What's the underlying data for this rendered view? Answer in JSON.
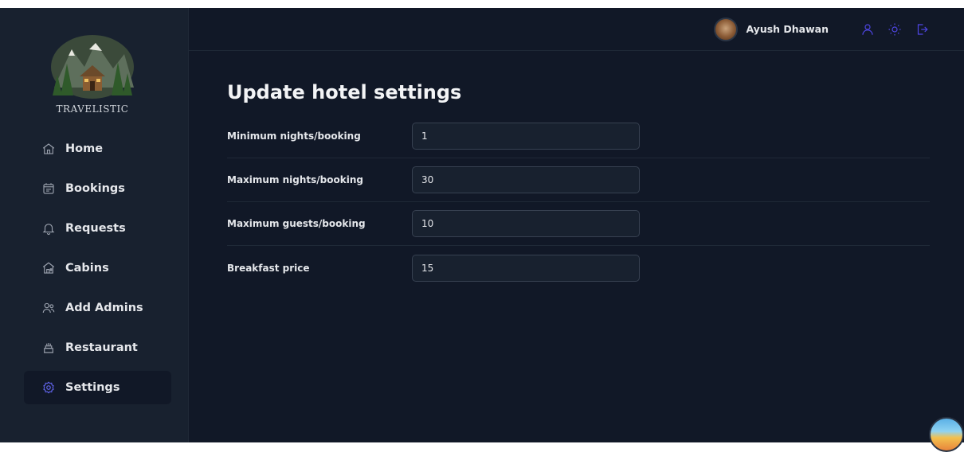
{
  "brand": {
    "name": "TRAVELISTIC"
  },
  "nav": [
    {
      "label": "Home",
      "icon": "home-icon",
      "active": false
    },
    {
      "label": "Bookings",
      "icon": "calendar-icon",
      "active": false
    },
    {
      "label": "Requests",
      "icon": "bell-icon",
      "active": false
    },
    {
      "label": "Cabins",
      "icon": "cabin-icon",
      "active": false
    },
    {
      "label": "Add Admins",
      "icon": "users-icon",
      "active": false
    },
    {
      "label": "Restaurant",
      "icon": "cake-icon",
      "active": false
    },
    {
      "label": "Settings",
      "icon": "gear-icon",
      "active": true
    }
  ],
  "header": {
    "user_name": "Ayush Dhawan",
    "icons": [
      "user-icon",
      "sun-icon",
      "logout-icon"
    ],
    "accent": "#4f46e5"
  },
  "page": {
    "title": "Update hotel settings"
  },
  "settings": [
    {
      "label": "Minimum nights/booking",
      "value": "1"
    },
    {
      "label": "Maximum nights/booking",
      "value": "30"
    },
    {
      "label": "Maximum guests/booking",
      "value": "10"
    },
    {
      "label": "Breakfast price",
      "value": "15"
    }
  ],
  "colors": {
    "background": "#111827",
    "sidebar": "#18212f",
    "text": "#e5e7eb"
  }
}
